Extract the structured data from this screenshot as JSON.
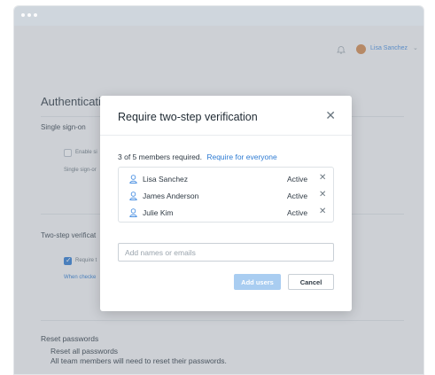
{
  "topbar": {
    "user_name": "Lisa Sanchez",
    "bell_icon": "bell-icon",
    "chevron_icon": "chevron-down-icon"
  },
  "page": {
    "title": "Authentication",
    "sso": {
      "label": "Single sign-on",
      "checkbox_label": "Enable si",
      "sub_text": "Single sign-or"
    },
    "two_step": {
      "label": "Two-step verificat",
      "checkbox_label": "Require t",
      "link_text": "When checke"
    },
    "reset": {
      "label": "Reset passwords",
      "link": "Reset all passwords",
      "note": "All team members will need to reset their passwords."
    }
  },
  "modal": {
    "title": "Require two-step verification",
    "close_icon": "close-icon",
    "required_text": "3 of 5 members required.",
    "require_all_link": "Require for everyone",
    "members": [
      {
        "name": "Lisa Sanchez",
        "status": "Active"
      },
      {
        "name": "James Anderson",
        "status": "Active"
      },
      {
        "name": "Julie Kim",
        "status": "Active"
      }
    ],
    "add_placeholder": "Add names or emails",
    "add_button": "Add users",
    "cancel_button": "Cancel"
  },
  "colors": {
    "accent": "#2f7cd3",
    "add_button_disabled": "#a9cdf1"
  }
}
